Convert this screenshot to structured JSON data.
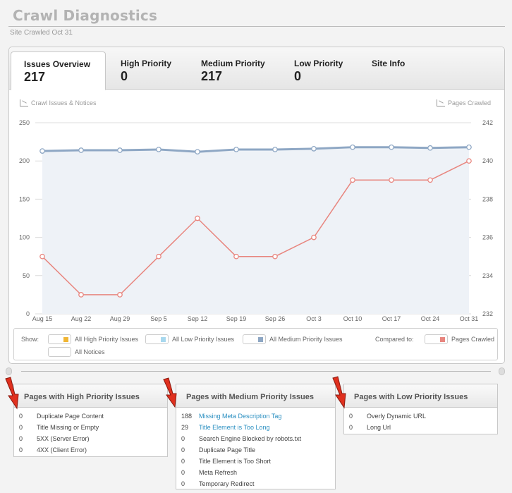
{
  "header": {
    "title": "Crawl Diagnostics",
    "subtitle": "Site Crawled Oct 31"
  },
  "tabs": [
    {
      "label": "Issues Overview",
      "count": "217"
    },
    {
      "label": "High Priority",
      "count": "0"
    },
    {
      "label": "Medium Priority",
      "count": "217"
    },
    {
      "label": "Low Priority",
      "count": "0"
    },
    {
      "label": "Site Info",
      "count": ""
    }
  ],
  "chart_links": {
    "left": "Crawl Issues & Notices",
    "right": "Pages Crawled"
  },
  "chart_data": {
    "type": "line",
    "categories": [
      "Aug 15",
      "Aug 22",
      "Aug 29",
      "Sep 5",
      "Sep 12",
      "Sep 19",
      "Sep 26",
      "Oct 3",
      "Oct 10",
      "Oct 17",
      "Oct 24",
      "Oct 31"
    ],
    "ylim_left": [
      0,
      250
    ],
    "yticks_left": [
      "250",
      "200",
      "150",
      "100",
      "50",
      "0"
    ],
    "ylim_right": [
      232,
      242
    ],
    "yticks_right": [
      "242",
      "240",
      "238",
      "236",
      "234",
      "232"
    ],
    "grid": true,
    "series": [
      {
        "axis": "left",
        "color": "#8ea7c4",
        "values": [
          213,
          214,
          214,
          215,
          212,
          215,
          215,
          216,
          218,
          218,
          217,
          218
        ],
        "area": true
      },
      {
        "axis": "right",
        "color": "#e8867f",
        "values": [
          235,
          233,
          233,
          235,
          237,
          235,
          235,
          236,
          239,
          239,
          239,
          240
        ]
      }
    ]
  },
  "show_panel": {
    "show_label": "Show:",
    "compared_label": "Compared to:",
    "items": [
      {
        "label": "All High Priority Issues",
        "color": "#f0b533"
      },
      {
        "label": "All Low Priority Issues",
        "color": "#a8d8ee"
      },
      {
        "label": "All Medium Priority Issues",
        "color": "#8ea7c4"
      },
      {
        "label": "All Notices",
        "color": ""
      },
      {
        "label": "Pages Crawled",
        "color": "#e8867f"
      }
    ]
  },
  "high_box": {
    "title": "Pages with High Priority Issues",
    "rows": [
      {
        "count": "0",
        "label": "Duplicate Page Content"
      },
      {
        "count": "0",
        "label": "Title Missing or Empty"
      },
      {
        "count": "0",
        "label": "5XX (Server Error)"
      },
      {
        "count": "0",
        "label": "4XX (Client Error)"
      }
    ]
  },
  "medium_box": {
    "title": "Pages with Medium Priority Issues",
    "rows": [
      {
        "count": "188",
        "label": "Missing Meta Description Tag",
        "link": true
      },
      {
        "count": "29",
        "label": "Title Element is Too Long",
        "link": true
      },
      {
        "count": "0",
        "label": "Search Engine Blocked by robots.txt"
      },
      {
        "count": "0",
        "label": "Duplicate Page Title"
      },
      {
        "count": "0",
        "label": "Title Element is Too Short"
      },
      {
        "count": "0",
        "label": "Meta Refresh"
      },
      {
        "count": "0",
        "label": "Temporary Redirect"
      }
    ]
  },
  "low_box": {
    "title": "Pages with Low Priority Issues",
    "rows": [
      {
        "count": "0",
        "label": "Overly Dynamic URL"
      },
      {
        "count": "0",
        "label": "Long Url"
      }
    ]
  },
  "arrow_color": "#e0301e"
}
